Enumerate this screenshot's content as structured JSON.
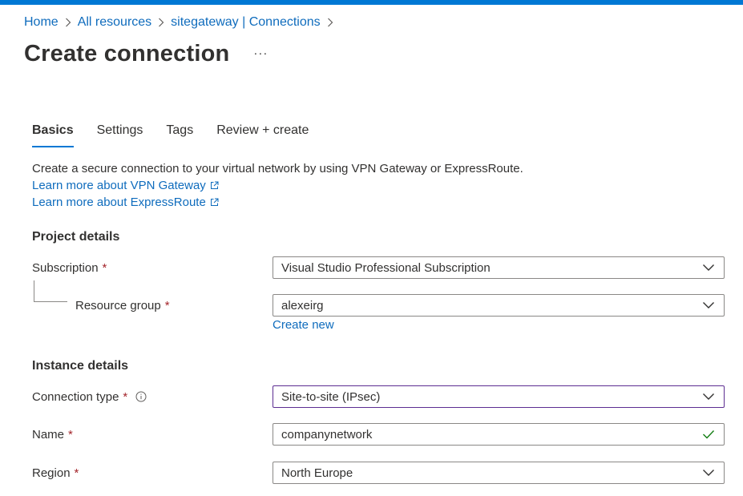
{
  "breadcrumb": {
    "items": [
      "Home",
      "All resources",
      "sitegateway | Connections"
    ]
  },
  "page": {
    "title": "Create connection",
    "more_label": "···"
  },
  "tabs": [
    {
      "label": "Basics",
      "active": true
    },
    {
      "label": "Settings",
      "active": false
    },
    {
      "label": "Tags",
      "active": false
    },
    {
      "label": "Review + create",
      "active": false
    }
  ],
  "intro": {
    "description": "Create a secure connection to your virtual network by using VPN Gateway or ExpressRoute.",
    "link_vpn": "Learn more about VPN Gateway",
    "link_expressroute": "Learn more about ExpressRoute"
  },
  "project_details": {
    "title": "Project details",
    "subscription": {
      "label": "Subscription",
      "required": "*",
      "value": "Visual Studio Professional Subscription"
    },
    "resource_group": {
      "label": "Resource group",
      "required": "*",
      "value": "alexeirg",
      "create_new": "Create new"
    }
  },
  "instance_details": {
    "title": "Instance details",
    "connection_type": {
      "label": "Connection type",
      "required": "*",
      "value": "Site-to-site (IPsec)"
    },
    "name": {
      "label": "Name",
      "required": "*",
      "value": "companynetwork"
    },
    "region": {
      "label": "Region",
      "required": "*",
      "value": "North Europe"
    }
  },
  "colors": {
    "accent": "#0078d4",
    "link": "#0f6cbd",
    "required": "#a4262c",
    "valid": "#107c10",
    "focus_border": "#5c2d91"
  },
  "icons": {
    "breadcrumb_separator": "chevron-right-icon",
    "external_link": "external-link-icon",
    "dropdown": "chevron-down-icon",
    "info": "info-icon",
    "valid": "checkmark-icon"
  }
}
